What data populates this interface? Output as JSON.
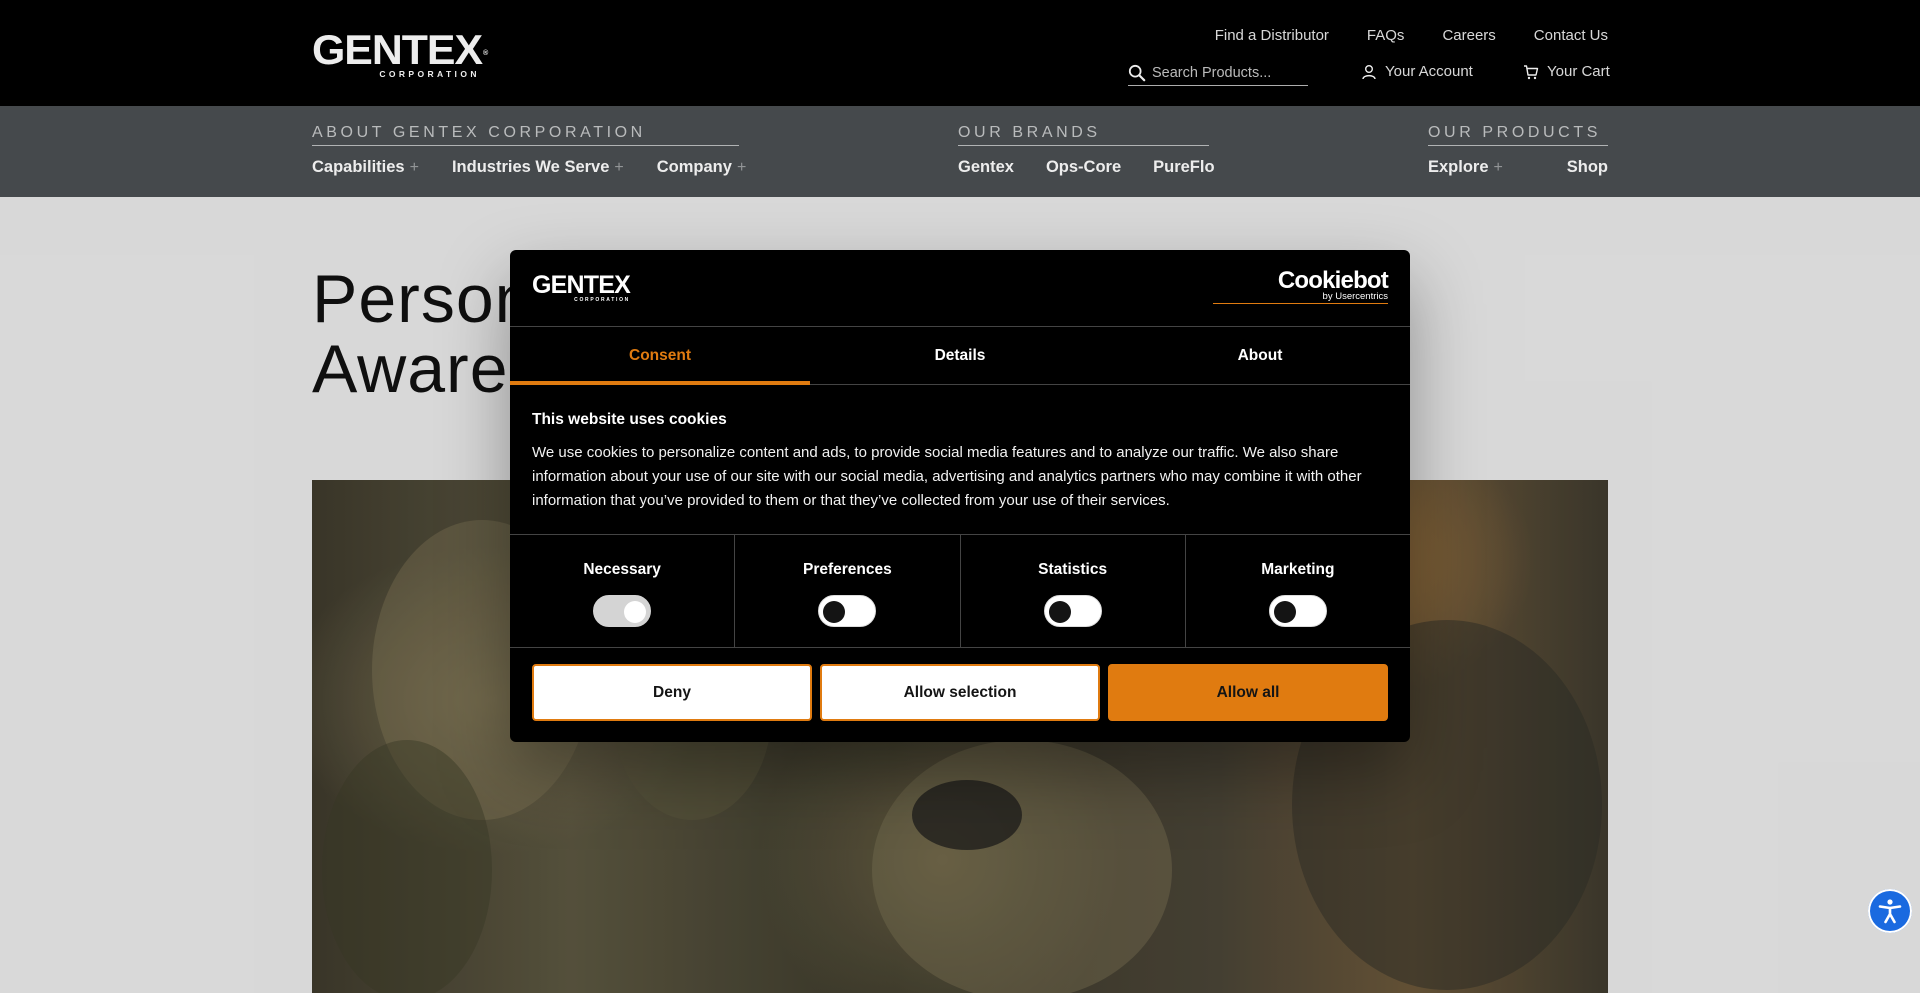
{
  "header": {
    "logo": {
      "word": "GENTEX",
      "registered": "®",
      "sub": "CORPORATION"
    },
    "utility_links": [
      "Find a Distributor",
      "FAQs",
      "Careers",
      "Contact Us"
    ],
    "search": {
      "placeholder": "Search Products..."
    },
    "account_label": "Your Account",
    "cart_label": "Your Cart"
  },
  "nav": {
    "about": {
      "heading": "ABOUT GENTEX CORPORATION",
      "items": [
        {
          "label": "Capabilities",
          "plus": "+"
        },
        {
          "label": "Industries We Serve",
          "plus": "+"
        },
        {
          "label": "Company",
          "plus": "+"
        }
      ]
    },
    "brands": {
      "heading": "OUR BRANDS",
      "items": [
        "Gentex",
        "Ops-Core",
        "PureFlo"
      ]
    },
    "products": {
      "heading": "OUR PRODUCTS",
      "items": [
        {
          "label": "Explore",
          "plus": "+"
        },
        {
          "label": "Shop"
        }
      ]
    }
  },
  "page": {
    "title_line1": "Person",
    "title_line2": "Awarer"
  },
  "cookie_dialog": {
    "logo": {
      "word": "GENTEX",
      "sub": "CORPORATION"
    },
    "provider": {
      "name": "Cookiebot",
      "by": "by Usercentrics"
    },
    "tabs": [
      "Consent",
      "Details",
      "About"
    ],
    "active_tab": "Consent",
    "heading": "This website uses cookies",
    "body": "We use cookies to personalize content and ads, to provide social media features and to analyze our traffic. We also share information about your use of our site with our social media, advertising and analytics partners who may combine it with other information that you’ve provided to them or that they’ve collected from your use of their services.",
    "categories": [
      {
        "label": "Necessary",
        "checked": true,
        "disabled": true
      },
      {
        "label": "Preferences",
        "checked": false
      },
      {
        "label": "Statistics",
        "checked": false
      },
      {
        "label": "Marketing",
        "checked": false
      }
    ],
    "buttons": {
      "deny": "Deny",
      "allow_selection": "Allow selection",
      "allow_all": "Allow all"
    },
    "accent_color": "#e07b10"
  },
  "icons": {
    "search": "search-icon",
    "account": "user-icon",
    "cart": "cart-icon",
    "accessibility": "accessibility-icon"
  },
  "colors": {
    "header_bg": "#000000",
    "nav_bg": "#4b4f52",
    "accessibility_bg": "#1a6ae0"
  }
}
